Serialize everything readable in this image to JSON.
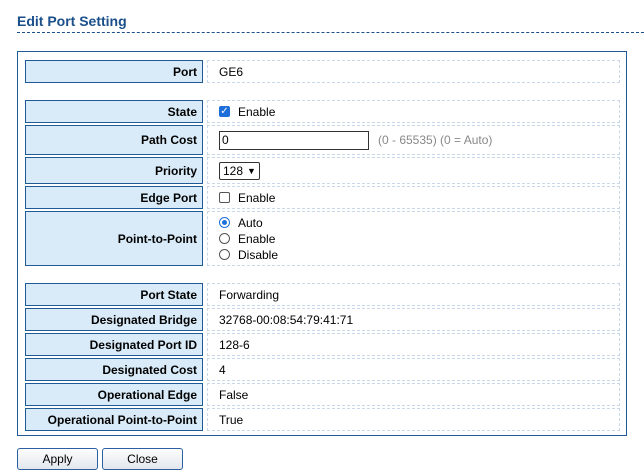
{
  "page_title": "Edit Port Setting",
  "rows": {
    "port": {
      "label": "Port",
      "value": "GE6"
    },
    "state": {
      "label": "State",
      "option": "Enable",
      "checked": true
    },
    "path_cost": {
      "label": "Path Cost",
      "value": "0",
      "hint": "(0 - 65535) (0 = Auto)"
    },
    "priority": {
      "label": "Priority",
      "value": "128"
    },
    "edge_port": {
      "label": "Edge Port",
      "option": "Enable",
      "checked": false
    },
    "p2p": {
      "label": "Point-to-Point",
      "options": [
        "Auto",
        "Enable",
        "Disable"
      ],
      "selected": "Auto"
    },
    "port_state": {
      "label": "Port State",
      "value": "Forwarding"
    },
    "designated_bridge": {
      "label": "Designated Bridge",
      "value": "32768-00:08:54:79:41:71"
    },
    "designated_port_id": {
      "label": "Designated Port ID",
      "value": "128-6"
    },
    "designated_cost": {
      "label": "Designated Cost",
      "value": "4"
    },
    "operational_edge": {
      "label": "Operational Edge",
      "value": "False"
    },
    "operational_p2p": {
      "label": "Operational Point-to-Point",
      "value": "True"
    }
  },
  "buttons": {
    "apply": "Apply",
    "close": "Close"
  },
  "colors": {
    "title": "#1a4f8a",
    "label_bg": "#d9ebf8",
    "border": "#1f5a97",
    "check": "#1e6fd9"
  }
}
